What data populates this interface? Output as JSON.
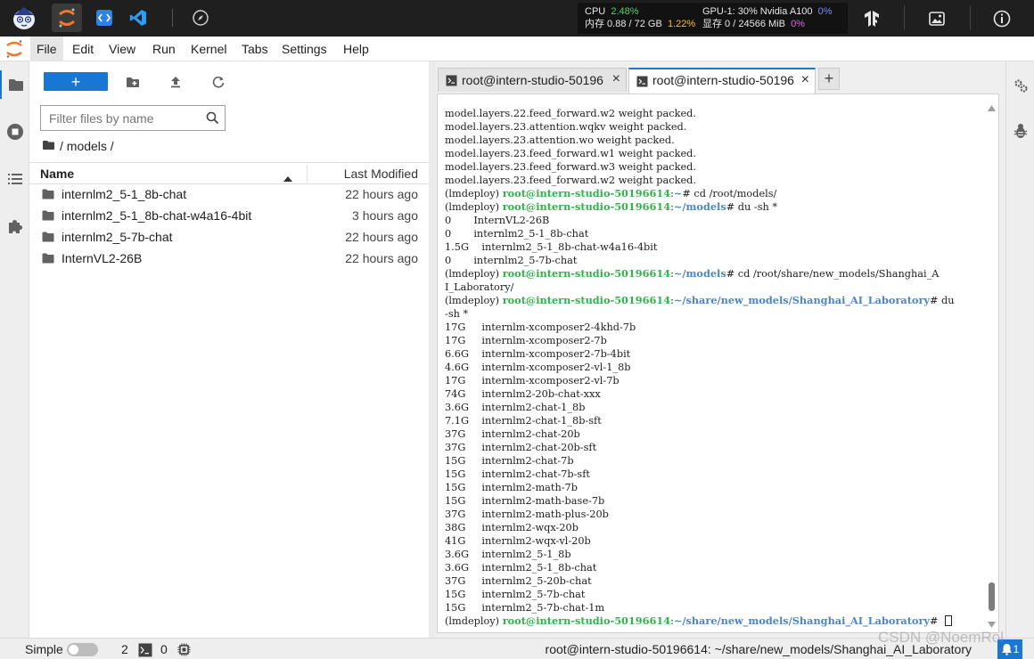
{
  "topbar": {
    "apps": [
      "intern-mascot-icon",
      "jupyter-icon",
      "code-editor-icon",
      "vscode-icon",
      "compass-icon"
    ],
    "cpu_label": "CPU",
    "cpu_value": "2.48%",
    "gpu_label": "GPU-1: 30% Nvidia A100",
    "gpu_value": "0%",
    "mem_label": "内存 0.88 / 72 GB",
    "mem_value": "1.22%",
    "vram_label": "显存 0 / 24566 MiB",
    "vram_value": "0%"
  },
  "menubar": {
    "items": [
      "File",
      "Edit",
      "View",
      "Run",
      "Kernel",
      "Tabs",
      "Settings",
      "Help"
    ],
    "active": "File"
  },
  "filebrowser": {
    "new_label": "+",
    "filter_placeholder": "Filter files by name",
    "breadcrumb": "/ models /",
    "col_name": "Name",
    "col_modified": "Last Modified",
    "rows": [
      {
        "name": "internlm2_5-1_8b-chat",
        "modified": "22 hours ago"
      },
      {
        "name": "internlm2_5-1_8b-chat-w4a16-4bit",
        "modified": "3 hours ago"
      },
      {
        "name": "internlm2_5-7b-chat",
        "modified": "22 hours ago"
      },
      {
        "name": "InternVL2-26B",
        "modified": "22 hours ago"
      }
    ]
  },
  "terminal": {
    "tabs": [
      {
        "label": "root@intern-studio-50196"
      },
      {
        "label": "root@intern-studio-50196"
      }
    ],
    "add_tab_label": "+",
    "lines": [
      {
        "text": "model.layers.22.feed_forward.w2 weight packed."
      },
      {
        "text": "model.layers.23.attention.wqkv weight packed."
      },
      {
        "text": "model.layers.23.attention.wo weight packed."
      },
      {
        "text": "model.layers.23.feed_forward.w1 weight packed."
      },
      {
        "text": "model.layers.23.feed_forward.w3 weight packed."
      },
      {
        "text": "model.layers.23.feed_forward.w2 weight packed."
      },
      {
        "env": "(lmdeploy) ",
        "user": "root@intern-studio-50196614",
        "sep": ":",
        "path": "~",
        "cmd": "# cd /root/models/"
      },
      {
        "env": "(lmdeploy) ",
        "user": "root@intern-studio-50196614",
        "sep": ":",
        "path": "~/models",
        "cmd": "# du -sh *"
      },
      {
        "text": "0       InternVL2-26B"
      },
      {
        "text": "0       internlm2_5-1_8b-chat"
      },
      {
        "text": "1.5G    internlm2_5-1_8b-chat-w4a16-4bit"
      },
      {
        "text": "0       internlm2_5-7b-chat"
      },
      {
        "env": "(lmdeploy) ",
        "user": "root@intern-studio-50196614",
        "sep": ":",
        "path": "~/models",
        "cmd": "# cd /root/share/new_models/Shanghai_A"
      },
      {
        "text": "I_Laboratory/"
      },
      {
        "env": "(lmdeploy) ",
        "user": "root@intern-studio-50196614",
        "sep": ":",
        "path": "~/share/new_models/Shanghai_AI_Laboratory",
        "cmd": "# du"
      },
      {
        "text": "-sh *"
      },
      {
        "text": "17G     internlm-xcomposer2-4khd-7b"
      },
      {
        "text": "17G     internlm-xcomposer2-7b"
      },
      {
        "text": "6.6G    internlm-xcomposer2-7b-4bit"
      },
      {
        "text": "4.6G    internlm-xcomposer2-vl-1_8b"
      },
      {
        "text": "17G     internlm-xcomposer2-vl-7b"
      },
      {
        "text": "74G     internlm2-20b-chat-xxx"
      },
      {
        "text": "3.6G    internlm2-chat-1_8b"
      },
      {
        "text": "7.1G    internlm2-chat-1_8b-sft"
      },
      {
        "text": "37G     internlm2-chat-20b"
      },
      {
        "text": "37G     internlm2-chat-20b-sft"
      },
      {
        "text": "15G     internlm2-chat-7b"
      },
      {
        "text": "15G     internlm2-chat-7b-sft"
      },
      {
        "text": "15G     internlm2-math-7b"
      },
      {
        "text": "15G     internlm2-math-base-7b"
      },
      {
        "text": "37G     internlm2-math-plus-20b"
      },
      {
        "text": "38G     internlm2-wqx-20b"
      },
      {
        "text": "41G     internlm2-wqx-vl-20b"
      },
      {
        "text": "3.6G    internlm2_5-1_8b"
      },
      {
        "text": "3.6G    internlm2_5-1_8b-chat"
      },
      {
        "text": "37G     internlm2_5-20b-chat"
      },
      {
        "text": "15G     internlm2_5-7b-chat"
      },
      {
        "text": "15G     internlm2_5-7b-chat-1m"
      },
      {
        "env": "(lmdeploy) ",
        "user": "root@intern-studio-50196614",
        "sep": ":",
        "path": "~/share/new_models/Shanghai_AI_Laboratory",
        "cmd": "# ",
        "cursor": true
      }
    ]
  },
  "statusbar": {
    "mode_label": "Simple",
    "terminals_count": "2",
    "kernels_count": "0",
    "path": "root@intern-studio-50196614: ~/share/new_models/Shanghai_AI_Laboratory",
    "bell_count": "1"
  },
  "watermark": "CSDN @NoemRol",
  "colors": {
    "accent": "#1976d2",
    "terminal_user": "#2fb34a",
    "terminal_path": "#4a86c8",
    "topbar_bg": "#1f1f1f"
  }
}
